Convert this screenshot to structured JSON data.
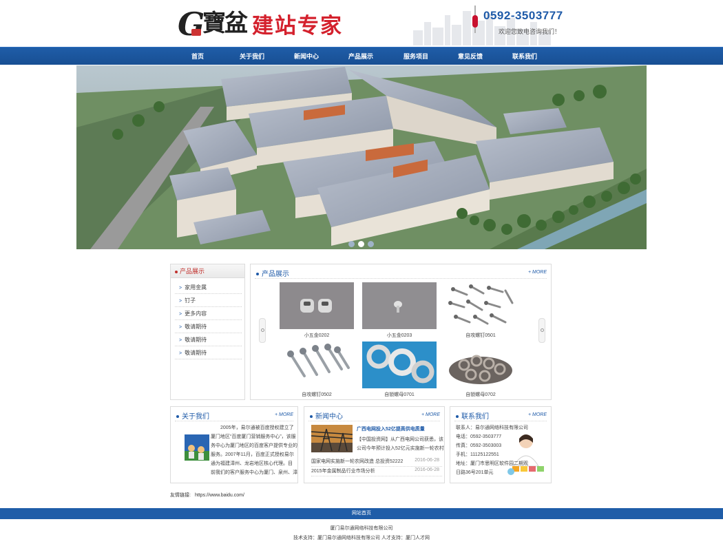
{
  "header": {
    "logo_letter": "G",
    "logo_mark": "寶盆",
    "logo_title": "建站专家",
    "phone": "0592-3503777",
    "welcome": "欢迎您致电咨询我们！"
  },
  "nav": {
    "items": [
      {
        "label": "首页"
      },
      {
        "label": "关于我们"
      },
      {
        "label": "新闻中心"
      },
      {
        "label": "产品展示"
      },
      {
        "label": "服务项目"
      },
      {
        "label": "意见反馈"
      },
      {
        "label": "联系我们"
      }
    ]
  },
  "banner": {
    "slide_count": 3,
    "active_slide": 2,
    "colors": {
      "active": "#ffffff",
      "inactive": "#9fb3c8"
    }
  },
  "sidebar": {
    "title": "产品展示",
    "items": [
      {
        "label": "家用金属"
      },
      {
        "label": "钉子"
      },
      {
        "label": "更多内容"
      },
      {
        "label": "敬请期待"
      },
      {
        "label": "敬请期待"
      },
      {
        "label": "敬请期待"
      }
    ]
  },
  "products": {
    "title": "产品展示",
    "more": "+ MORE",
    "items": [
      {
        "caption": "小五金0202",
        "image": "nut-pair-image"
      },
      {
        "caption": "小五金0203",
        "image": "small-rivet-image"
      },
      {
        "caption": "自攻螺钉0501",
        "image": "assorted-screws-image"
      },
      {
        "caption": "自攻螺钉0502",
        "image": "self-tapping-screws-image"
      },
      {
        "caption": "自锁螺母0701",
        "image": "lock-washers-image"
      },
      {
        "caption": "自锁螺母0702",
        "image": "washer-pile-image"
      }
    ]
  },
  "about": {
    "title": "关于我们",
    "more": "+ MORE",
    "lines": [
      "2005年，易尔通被百度授权建立了",
      "厦门地区“百度厦门营销服务中心”，该服",
      "务中心为厦门地区的百度客户提供专业的",
      "服务。2007年11月，百度正式授权易尔",
      "通为福建漳州、龙岩地区核心代理。目",
      "前我们的客户服务中心为厦门、泉州、漳"
    ]
  },
  "news": {
    "title": "新闻中心",
    "more": "+ MORE",
    "headline": "广西电网投入52亿提高供电质量",
    "summary_lines": [
      "【中国投资网】从广西电网公司获悉，该",
      "公司今年预计投入52亿元实施新一轮农村"
    ],
    "rows": [
      {
        "title": "国家电网实施新一轮农网改造 总投资52222",
        "date": "2016-06-28"
      },
      {
        "title": "2015年金属制品行业市场分析",
        "date": "2016-06-28"
      }
    ]
  },
  "contact": {
    "title": "联系我们",
    "more": "+ MORE",
    "lines": [
      "联系人：易尔通网络科技有限公司",
      "电话：0592-3503777",
      "传真：0592-3503003",
      "手机：11125122551",
      "地址：厦门市思明区软件园二期观",
      "日路36号201单元"
    ]
  },
  "links": {
    "label": "友情链接:",
    "items": [
      {
        "label": "https://www.baidu.com/"
      }
    ]
  },
  "footer": {
    "link": "网站首页",
    "company": "厦门易尔通网络科技有限公司",
    "support": "技术支持：厦门易尔通网络科技有限公司 人才支持：厦门人才网"
  },
  "colors": {
    "brand_blue": "#1f5da8",
    "logo_red": "#d4212d",
    "sidebar_red": "#c0302c"
  }
}
